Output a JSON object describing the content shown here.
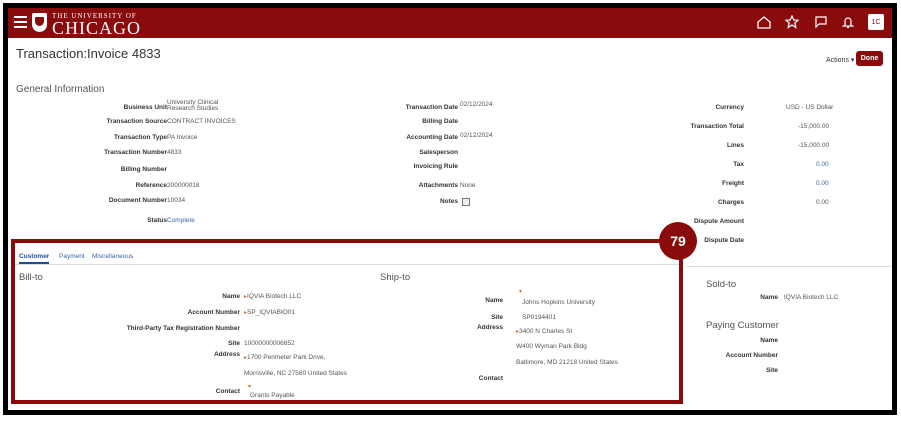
{
  "header": {
    "brand_small": "THE UNIVERSITY OF",
    "brand_big": "CHICAGO",
    "avatar": "1C",
    "icons": [
      "menu-icon",
      "home-icon",
      "star-icon",
      "flag-icon",
      "bell-icon"
    ]
  },
  "page": {
    "title": "Transaction:Invoice 4833",
    "actions_label": "Actions ▾",
    "done_label": "Done"
  },
  "general": {
    "section_title": "General Information",
    "left": [
      {
        "label": "Business Unit",
        "value": "University Clinical Research Studies"
      },
      {
        "label": "Transaction Source",
        "value": "CONTRACT INVOICES"
      },
      {
        "label": "Transaction Type",
        "value": "PA Invoice"
      },
      {
        "label": "Transaction Number",
        "value": "4833"
      },
      {
        "label": "Billing Number",
        "value": ""
      },
      {
        "label": "Reference",
        "value": "200000018"
      },
      {
        "label": "Document Number",
        "value": "10034"
      },
      {
        "label": "Status",
        "value": "Complete"
      }
    ],
    "business_unit_line1": "University Clinical",
    "business_unit_line2": "Research Studies",
    "middle": [
      {
        "label": "Transaction Date",
        "value": "02/12/2024"
      },
      {
        "label": "Billing Date",
        "value": ""
      },
      {
        "label": "Accounting Date",
        "value": "02/12/2024"
      },
      {
        "label": "Salesperson",
        "value": ""
      },
      {
        "label": "Invoicing Rule",
        "value": ""
      },
      {
        "label": "Attachments",
        "value": "None"
      },
      {
        "label": "Notes",
        "value": ""
      }
    ],
    "right": [
      {
        "label": "Currency",
        "value": "USD - US Dollar"
      },
      {
        "label": "Transaction Total",
        "value": "-15,000.00"
      },
      {
        "label": "Lines",
        "value": "-15,000.00"
      },
      {
        "label": "Tax",
        "value": "0.00"
      },
      {
        "label": "Freight",
        "value": "0.00"
      },
      {
        "label": "Charges",
        "value": "0.00"
      },
      {
        "label": "Dispute Amount",
        "value": ""
      },
      {
        "label": "Dispute Date",
        "value": ""
      }
    ]
  },
  "badge": "79",
  "tabs": [
    "Customer",
    "Payment",
    "Miscellaneous"
  ],
  "bill_to": {
    "title": "Bill-to",
    "name_label": "Name",
    "name": "IQVIA Biotech LLC",
    "account_label": "Account Number",
    "account": "SP_IQVIABIO01",
    "tax_label": "Third-Party Tax Registration Number",
    "site_label": "Site",
    "site": "10000000006852",
    "address_label": "Address",
    "address1": "1700 Perimeter Park Drive,",
    "address2": "Morrisville, NC 27560 United States",
    "contact_label": "Contact",
    "contact": "Grants Payable"
  },
  "ship_to": {
    "title": "Ship-to",
    "name_label": "Name",
    "name": "Johns Hopkins University",
    "site_label": "Site",
    "site": "SP0194401",
    "address_label": "Address",
    "address1": "3400 N Charles St",
    "address2": "W400 Wyman Park Bldg",
    "address3": "Baltimore, MD 21218 United States",
    "contact_label": "Contact"
  },
  "sold_to": {
    "title": "Sold-to",
    "name_label": "Name",
    "name": "IQVIA Biotech LLC"
  },
  "paying": {
    "title": "Paying Customer",
    "name_label": "Name",
    "account_label": "Account Number",
    "site_label": "Site"
  }
}
